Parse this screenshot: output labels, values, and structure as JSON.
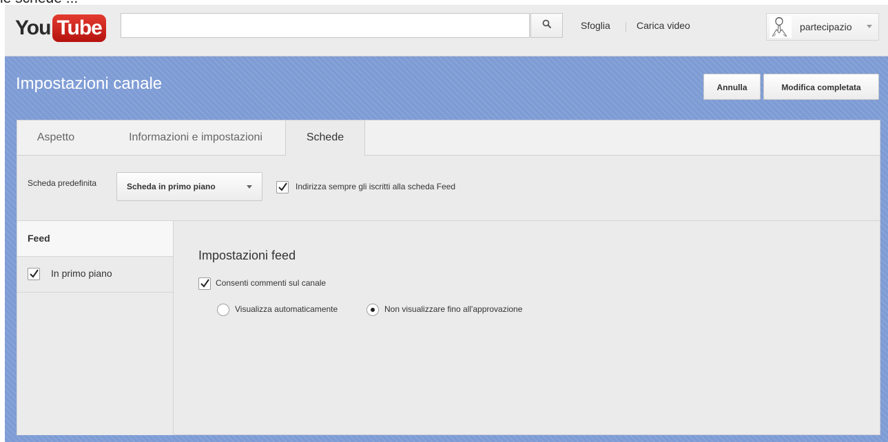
{
  "top_crop_text": "le schede ...",
  "header": {
    "logo_you": "You",
    "logo_tube": "Tube",
    "search_placeholder": "",
    "nav_browse": "Sfoglia",
    "nav_upload": "Carica video",
    "account_name": "partecipazio"
  },
  "page": {
    "title": "Impostazioni canale",
    "cancel_button": "Annulla",
    "done_button": "Modifica completata"
  },
  "tabs": [
    {
      "label": "Aspetto",
      "active": false
    },
    {
      "label": "Informazioni e impostazioni",
      "active": false
    },
    {
      "label": "Schede",
      "active": true
    }
  ],
  "default_tab": {
    "label": "Scheda predefinita",
    "selected": "Scheda in primo piano",
    "redirect_checkbox_label": "Indirizza sempre gli iscritti alla scheda Feed",
    "redirect_checked": true
  },
  "sidebar": {
    "feed": "Feed",
    "featured_label": "In primo piano",
    "featured_checked": true
  },
  "feed_settings": {
    "title": "Impostazioni feed",
    "allow_comments_label": "Consenti commenti sul canale",
    "allow_comments_checked": true,
    "radio_auto": "Visualizza automaticamente",
    "radio_approval": "Non visualizzare fino all'approvazione",
    "selected_option": "approval"
  },
  "colors": {
    "background_blue": "#7d9bd4",
    "logo_red": "#d3221c"
  }
}
